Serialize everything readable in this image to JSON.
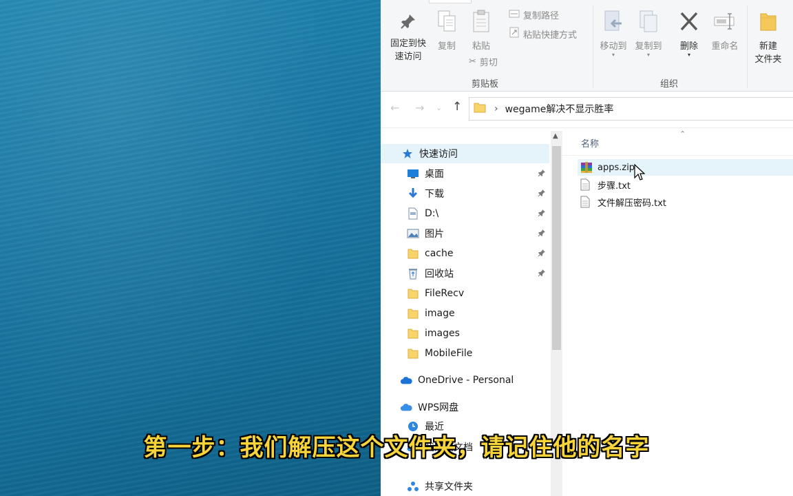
{
  "ribbon": {
    "clipboard": {
      "pin_label_line1": "固定到快",
      "pin_label_line2": "速访问",
      "copy_label": "复制",
      "paste_label": "粘贴",
      "copy_path_label": "复制路径",
      "paste_shortcut_label": "粘贴快捷方式",
      "cut_label": "剪切",
      "group_label": "剪贴板"
    },
    "organize": {
      "move_to_label": "移动到",
      "copy_to_label": "复制到",
      "delete_label": "删除",
      "rename_label": "重命名",
      "group_label": "组织"
    },
    "new": {
      "new_folder_line1": "新建",
      "new_folder_line2": "文件夹"
    }
  },
  "address": {
    "path_separator": "›",
    "current_folder": "wegame解决不显示胜率"
  },
  "nav_pane": {
    "quick_access_label": "快速访问",
    "items": [
      {
        "label": "桌面",
        "icon": "desktop-icon",
        "pinned": true
      },
      {
        "label": "下载",
        "icon": "download-icon",
        "pinned": true
      },
      {
        "label": "D:\\",
        "icon": "drive-icon",
        "pinned": true
      },
      {
        "label": "图片",
        "icon": "pictures-icon",
        "pinned": true
      },
      {
        "label": "cache",
        "icon": "folder-icon",
        "pinned": true
      },
      {
        "label": "回收站",
        "icon": "recycle-bin-icon",
        "pinned": true
      },
      {
        "label": "FileRecv",
        "icon": "folder-icon",
        "pinned": false
      },
      {
        "label": "image",
        "icon": "folder-icon",
        "pinned": false
      },
      {
        "label": "images",
        "icon": "folder-icon",
        "pinned": false
      },
      {
        "label": "MobileFile",
        "icon": "folder-icon",
        "pinned": false
      }
    ],
    "onedrive_label": "OneDrive - Personal",
    "wps_label": "WPS网盘",
    "wps_items": [
      "最近",
      "我的云文档",
      "共享文件夹"
    ]
  },
  "content": {
    "column_name": "名称",
    "files": [
      {
        "name": "apps.zip",
        "icon": "zip-archive-icon"
      },
      {
        "name": "步骤.txt",
        "icon": "text-file-icon"
      },
      {
        "name": "文件解压密码.txt",
        "icon": "text-file-icon"
      }
    ]
  },
  "subtitle": "第一步：我们解压这个文件夹，请记住他的名字",
  "colors": {
    "subtitle_text": "#f6d43a",
    "selection": "#e5f3fb",
    "desktop_sea": "#1a7aa6"
  }
}
